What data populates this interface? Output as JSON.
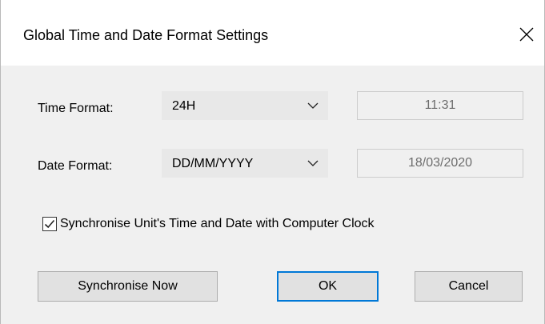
{
  "window": {
    "title": "Global Time and Date Format Settings",
    "close_icon": "close-icon"
  },
  "time_format": {
    "label": "Time Format:",
    "selected": "24H",
    "preview": "11:31"
  },
  "date_format": {
    "label": "Date Format:",
    "selected": "DD/MM/YYYY",
    "preview": "18/03/2020"
  },
  "sync_checkbox": {
    "label": "Synchronise Unit's Time and Date with Computer Clock",
    "checked": true
  },
  "buttons": {
    "sync_now": "Synchronise Now",
    "ok": "OK",
    "cancel": "Cancel"
  },
  "colors": {
    "accent": "#0078d7",
    "dialog_bg": "#f0f0f0",
    "titlebar_bg": "#ffffff"
  }
}
